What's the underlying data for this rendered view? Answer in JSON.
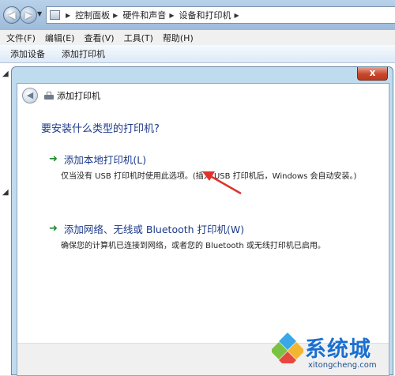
{
  "address_bar": {
    "segments": [
      "控制面板",
      "硬件和声音",
      "设备和打印机"
    ]
  },
  "menubar": {
    "items": [
      "文件(F)",
      "编辑(E)",
      "查看(V)",
      "工具(T)",
      "帮助(H)"
    ]
  },
  "toolbar": {
    "add_device": "添加设备",
    "add_printer": "添加打印机"
  },
  "dialog": {
    "title": "添加打印机",
    "close_label": "x",
    "question": "要安装什么类型的打印机?",
    "options": [
      {
        "title": "添加本地打印机(L)",
        "description": "仅当没有 USB 打印机时使用此选项。(插入 USB 打印机后，Windows 会自动安装。)"
      },
      {
        "title": "添加网络、无线或 Bluetooth 打印机(W)",
        "description": "确保您的计算机已连接到网络，或者您的 Bluetooth 或无线打印机已启用。"
      }
    ]
  },
  "watermark": {
    "name": "系统城",
    "url": "xitongcheng.com"
  },
  "colors": {
    "link_blue": "#1d3a8a",
    "arrow_green": "#1f8c2f",
    "annotation_red": "#e0322b",
    "close_red": "#c8462c"
  }
}
